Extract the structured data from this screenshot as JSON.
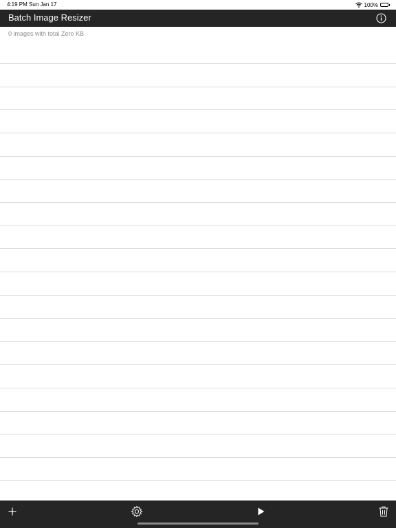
{
  "status_bar": {
    "time": "4:19 PM",
    "date": "Sun Jan 17",
    "battery": "100%",
    "icons": [
      "wifi-icon",
      "battery-icon"
    ]
  },
  "nav": {
    "title": "Batch Image Resizer",
    "info_icon": "info-icon"
  },
  "summary": {
    "text": "0 images with total Zero KB"
  },
  "toolbar": {
    "icons": [
      "plus-icon",
      "gear-icon",
      "play-icon",
      "trash-icon"
    ]
  },
  "colors": {
    "bar_background": "#252525",
    "bar_foreground": "#ffffff",
    "summary_text": "#8e8e93",
    "separator": "#dcdcdc"
  }
}
